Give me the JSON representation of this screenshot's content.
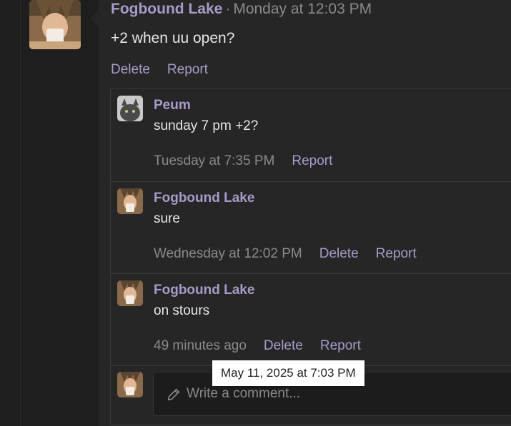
{
  "post": {
    "author": "Fogbound Lake",
    "separator": "·",
    "timestamp": "Monday at 12:03 PM",
    "body": "+2 when uu open?",
    "delete_label": "Delete",
    "report_label": "Report"
  },
  "comments": [
    {
      "author": "Peum",
      "body": "sunday 7 pm +2?",
      "time": "Tuesday at 7:35 PM",
      "report_label": "Report"
    },
    {
      "author": "Fogbound Lake",
      "body": "sure",
      "time": "Wednesday at 12:02 PM",
      "delete_label": "Delete",
      "report_label": "Report"
    },
    {
      "author": "Fogbound Lake",
      "body": "on stours",
      "time": "49 minutes ago",
      "delete_label": "Delete",
      "report_label": "Report"
    }
  ],
  "compose": {
    "placeholder": "Write a comment...",
    "icon": "pencil-icon"
  },
  "tooltip": {
    "text": "May 11, 2025 at 7:03 PM"
  },
  "colors": {
    "accent": "#a89bc9",
    "muted": "#8a8a8a",
    "background": "#262626"
  }
}
